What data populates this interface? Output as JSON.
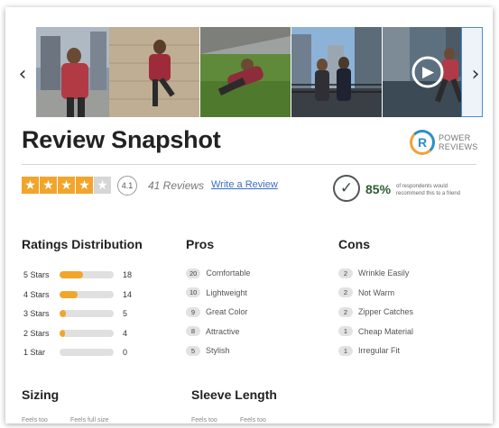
{
  "carousel": {
    "prev_icon": "chevron-left-icon",
    "next_icon": "chevron-right-icon",
    "prev_glyph": "‹",
    "next_glyph": "›",
    "play_glyph": "▶"
  },
  "header": {
    "title": "Review Snapshot",
    "logo_mark": "R",
    "logo_line1": "POWER",
    "logo_line2": "REVIEWS"
  },
  "rating": {
    "stars_filled": 4,
    "stars_total": 5,
    "star_glyph": "★",
    "average": "4.1",
    "reviews": "41 Reviews",
    "write_review": "Write a Review",
    "recommend_pct": "85%",
    "recommend_text": "of respondents would recommend this to a friend",
    "check_glyph": "✓",
    "accent_color": "#f2a52b"
  },
  "distribution": {
    "heading": "Ratings Distribution",
    "rows": [
      {
        "label": "5 Stars",
        "count": "18",
        "fraction": 0.44
      },
      {
        "label": "4 Stars",
        "count": "14",
        "fraction": 0.34
      },
      {
        "label": "3 Stars",
        "count": "5",
        "fraction": 0.12
      },
      {
        "label": "2 Stars",
        "count": "4",
        "fraction": 0.1
      },
      {
        "label": "1 Star",
        "count": "0",
        "fraction": 0.0
      }
    ]
  },
  "pros": {
    "heading": "Pros",
    "items": [
      {
        "count": "20",
        "label": "Comfortable"
      },
      {
        "count": "10",
        "label": "Lightweight"
      },
      {
        "count": "9",
        "label": "Great Color"
      },
      {
        "count": "8",
        "label": "Attractive"
      },
      {
        "count": "5",
        "label": "Stylish"
      }
    ]
  },
  "cons": {
    "heading": "Cons",
    "items": [
      {
        "count": "2",
        "label": "Wrinkle Easily"
      },
      {
        "count": "2",
        "label": "Not Warm"
      },
      {
        "count": "2",
        "label": "Zipper Catches"
      },
      {
        "count": "1",
        "label": "Cheap Material"
      },
      {
        "count": "1",
        "label": "Irregular Fit"
      }
    ]
  },
  "sizing": {
    "heading": "Sizing",
    "caption_left": "Feels too",
    "caption_right": "Feels full size"
  },
  "sleeve": {
    "heading": "Sleeve Length",
    "caption_left": "Feels too",
    "caption_right": "Feels too"
  }
}
